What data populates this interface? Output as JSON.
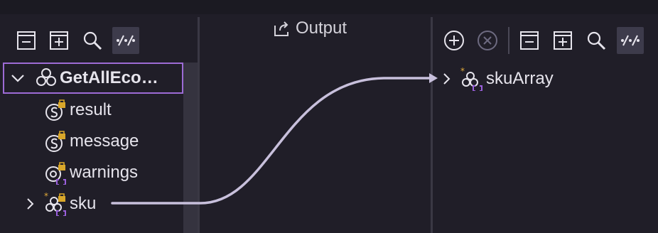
{
  "output_header": {
    "label": "Output",
    "icon": "export-icon"
  },
  "source_toolbar": [
    {
      "name": "collapse-all",
      "icon": "collapse-all-icon"
    },
    {
      "name": "expand-all",
      "icon": "expand-all-icon"
    },
    {
      "name": "search",
      "icon": "search-icon"
    },
    {
      "name": "toggle-mapped",
      "icon": "toggle-mapped-icon",
      "active": true
    }
  ],
  "target_toolbar": [
    {
      "name": "add",
      "icon": "add-circle-icon"
    },
    {
      "name": "remove",
      "icon": "remove-circle-icon",
      "disabled": true
    },
    {
      "name": "collapse-all",
      "icon": "collapse-all-icon"
    },
    {
      "name": "expand-all",
      "icon": "expand-all-icon"
    },
    {
      "name": "search",
      "icon": "search-icon"
    },
    {
      "name": "toggle-mapped",
      "icon": "toggle-mapped-icon",
      "active": true
    }
  ],
  "source_tree": {
    "root": {
      "label": "GetAllEco…",
      "expanded": true,
      "icon": "object-icon"
    },
    "children": [
      {
        "label": "result",
        "icon": "string-locked-icon"
      },
      {
        "label": "message",
        "icon": "string-locked-icon"
      },
      {
        "label": "warnings",
        "icon": "string-array-locked-icon"
      },
      {
        "label": "sku",
        "icon": "object-array-locked-required-icon",
        "expandable": true
      }
    ]
  },
  "target_tree": [
    {
      "label": "skuArray",
      "icon": "object-array-required-icon",
      "expandable": true
    }
  ],
  "mapping": {
    "from": "sku",
    "to": "skuArray"
  },
  "colors": {
    "accent": "#9d6bd6",
    "lock": "#d9a72a",
    "array": "#9a5fdc",
    "required": "#e0a93a"
  }
}
